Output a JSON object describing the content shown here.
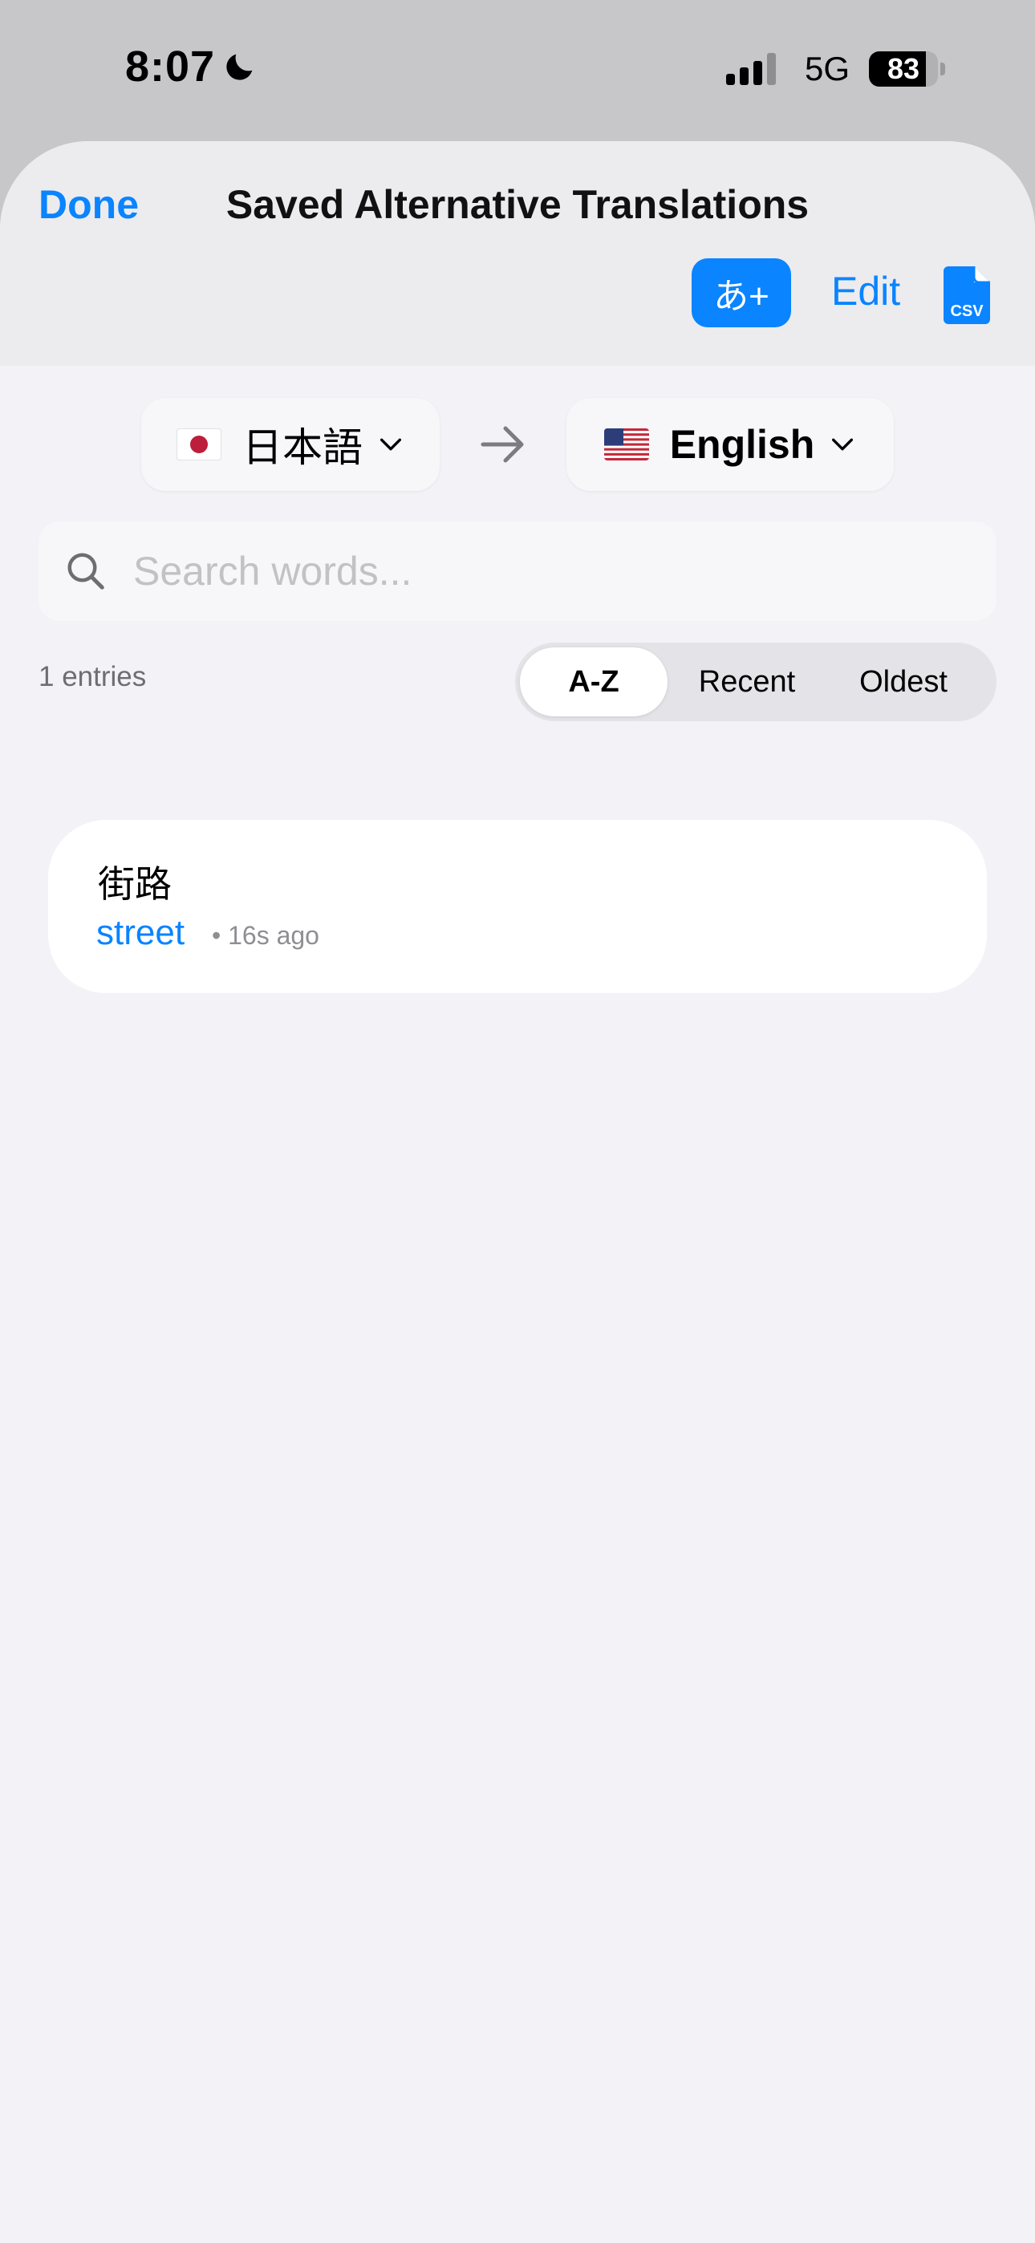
{
  "status_bar": {
    "time": "8:07",
    "network": "5G",
    "battery_percent": "83",
    "battery_level": 0.83,
    "signal_bars_filled": 3,
    "signal_bars_total": 4
  },
  "header": {
    "done_label": "Done",
    "title": "Saved Alternative Translations",
    "add_label": "あ+",
    "edit_label": "Edit",
    "csv_label": "CSV"
  },
  "languages": {
    "from": {
      "label": "日本語",
      "flag": "jp-flag"
    },
    "to": {
      "label": "English",
      "flag": "us-flag"
    }
  },
  "search": {
    "placeholder": "Search words...",
    "value": ""
  },
  "list": {
    "count_text": "1 entries",
    "sort_options": [
      "A-Z",
      "Recent",
      "Oldest"
    ],
    "selected_sort": "A-Z",
    "entries": [
      {
        "source": "街路",
        "translation": "street",
        "time": "• 16s ago"
      }
    ]
  },
  "colors": {
    "accent": "#0a84ff",
    "sheet_background": "#f2f2f7",
    "card_background": "#ffffff"
  }
}
